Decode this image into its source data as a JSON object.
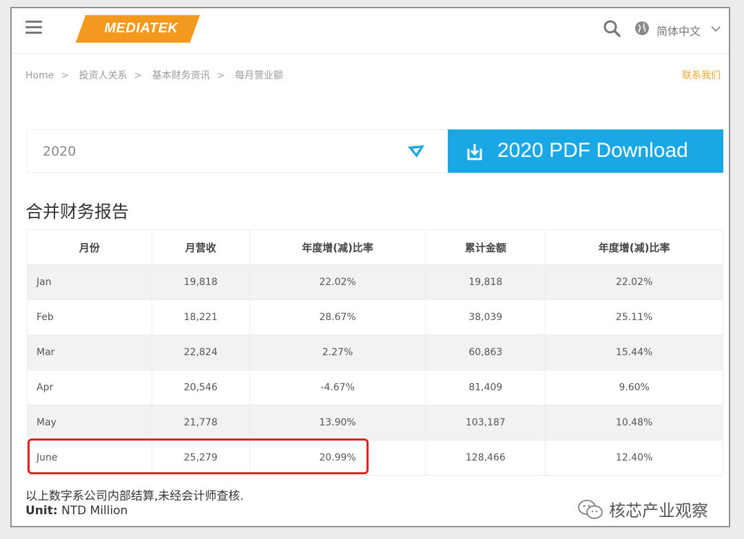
{
  "header": {
    "logo_text": "MEDIATEK",
    "language": "简体中文",
    "menu_icon": "hamburger-icon",
    "search_icon": "search-icon",
    "globe_icon": "globe-icon",
    "brand_color": "#f39a1e"
  },
  "breadcrumb": {
    "items": [
      "Home",
      "投资人关系",
      "基本财务资讯",
      "每月营业额"
    ],
    "separator": ">"
  },
  "contact_link": "联系我们",
  "year_select": {
    "value": "2020"
  },
  "pdf_button": {
    "label": "2020 PDF Download",
    "color": "#1aa7e6"
  },
  "section_title": "合并财务报告",
  "table": {
    "columns": [
      "月份",
      "月营收",
      "年度增(减)比率",
      "累计金额",
      "年度增(减)比率"
    ],
    "rows": [
      [
        "Jan",
        "19,818",
        "22.02%",
        "19,818",
        "22.02%"
      ],
      [
        "Feb",
        "18,221",
        "28.67%",
        "38,039",
        "25.11%"
      ],
      [
        "Mar",
        "22,824",
        "2.27%",
        "60,863",
        "15.44%"
      ],
      [
        "Apr",
        "20,546",
        "-4.67%",
        "81,409",
        "9.60%"
      ],
      [
        "May",
        "21,778",
        "13.90%",
        "103,187",
        "10.48%"
      ],
      [
        "June",
        "25,279",
        "20.99%",
        "128,466",
        "12.40%"
      ]
    ],
    "highlight_color": "#e02020"
  },
  "footnote": "以上数字系公司内部结算,未经会计师查核.",
  "unit": {
    "label": "Unit:",
    "value": " NTD Million"
  },
  "watermark": "核芯产业观察"
}
